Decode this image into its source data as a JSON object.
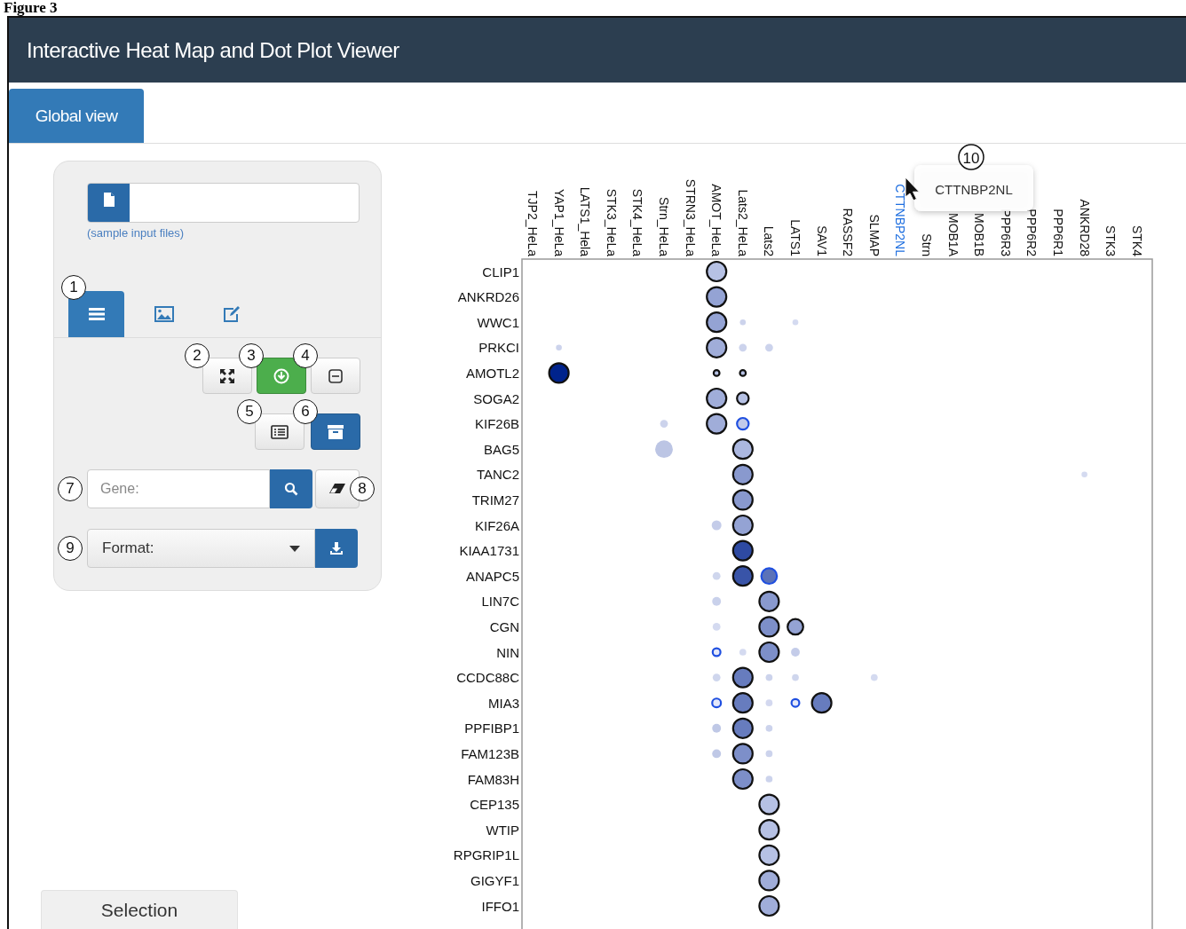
{
  "figure_label": "Figure 3",
  "window": {
    "title": "Interactive Heat Map and Dot Plot Viewer"
  },
  "tabs": [
    {
      "label": "Global view",
      "selected": true
    }
  ],
  "sidebar": {
    "file_input": {
      "link": "(sample input files)"
    },
    "view_tabs": [
      {
        "kind": "list",
        "selected": true,
        "callout": "1"
      },
      {
        "kind": "image",
        "selected": false
      },
      {
        "kind": "edit",
        "selected": false
      }
    ],
    "tool_buttons": [
      {
        "kind": "expand",
        "callout": "2"
      },
      {
        "kind": "download-circle",
        "callout": "3"
      },
      {
        "kind": "minus-square",
        "callout": "4"
      }
    ],
    "tool_buttons_2": [
      {
        "kind": "list-alt",
        "callout": "5"
      },
      {
        "kind": "archive",
        "callout": "6"
      }
    ],
    "gene_search": {
      "placeholder": "Gene:",
      "callout": "7"
    },
    "clear_button": {
      "callout": "8"
    },
    "format_select": {
      "placeholder": "Format:",
      "callout": "9"
    }
  },
  "bottom_tabs": [
    {
      "label": "Selection",
      "selected": false
    }
  ],
  "dot_plot": {
    "columns": [
      {
        "label": "TJP2_HeLa",
        "selected": false
      },
      {
        "label": "YAP1_HeLa",
        "selected": false
      },
      {
        "label": "LATS1_Hela",
        "selected": false
      },
      {
        "label": "STK3_HeLa",
        "selected": false
      },
      {
        "label": "STK4_HeLa",
        "selected": false
      },
      {
        "label": "Strn_HeLa",
        "selected": false
      },
      {
        "label": "STRN3_HeLa",
        "selected": false
      },
      {
        "label": "AMOT_HeLa",
        "selected": false
      },
      {
        "label": "Lats2_HeLa",
        "selected": false
      },
      {
        "label": "Lats2",
        "selected": false
      },
      {
        "label": "LATS1",
        "selected": false
      },
      {
        "label": "SAV1",
        "selected": false
      },
      {
        "label": "RASSF2",
        "selected": false
      },
      {
        "label": "SLMAP",
        "selected": false
      },
      {
        "label": "CTTNBP2NL",
        "selected": true
      },
      {
        "label": "Strn",
        "selected": false
      },
      {
        "label": "MOB1A",
        "selected": false
      },
      {
        "label": "MOB1B",
        "selected": false
      },
      {
        "label": "PPP6R3",
        "selected": false
      },
      {
        "label": "PPP6R2",
        "selected": false
      },
      {
        "label": "PPP6R1",
        "selected": false
      },
      {
        "label": "ANKRD28",
        "selected": false
      },
      {
        "label": "STK3",
        "selected": false
      },
      {
        "label": "STK4",
        "selected": false
      }
    ],
    "rows": [
      "CLIP1",
      "ANKRD26",
      "WWC1",
      "PRKCI",
      "AMOTL2",
      "SOGA2",
      "KIF26B",
      "BAG5",
      "TANC2",
      "TRIM27",
      "KIF26A",
      "KIAA1731",
      "ANAPC5",
      "LIN7C",
      "CGN",
      "NIN",
      "CCDC88C",
      "MIA3",
      "PPFIBP1",
      "FAM123B",
      "FAM83H",
      "CEP135",
      "WTIP",
      "RPGRIP1L",
      "GIGYF1",
      "IFFO1"
    ],
    "tooltip": {
      "text": "CTTNBP2NL",
      "callout": "10"
    }
  }
}
